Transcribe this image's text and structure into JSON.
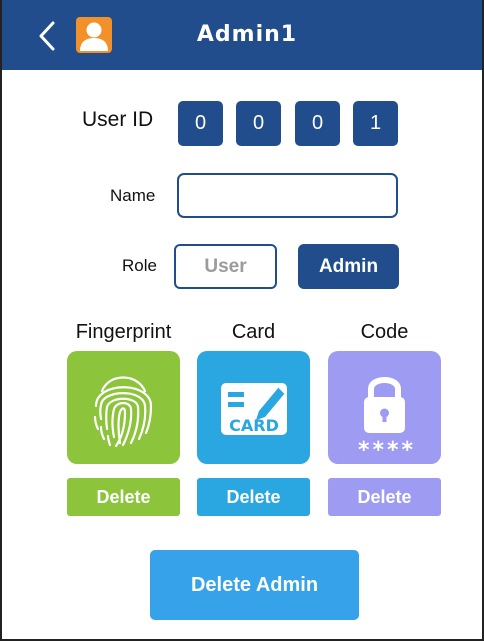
{
  "header": {
    "title": "Admin1",
    "back_icon": "chevron-left-icon",
    "avatar_icon": "user-avatar-icon"
  },
  "user_id": {
    "label": "User ID",
    "digits": [
      "0",
      "0",
      "0",
      "1"
    ]
  },
  "name": {
    "label": "Name",
    "value": "",
    "placeholder": ""
  },
  "role": {
    "label": "Role",
    "options": [
      "User",
      "Admin"
    ],
    "selected": "Admin"
  },
  "credentials": [
    {
      "title": "Fingerprint",
      "icon": "fingerprint-icon",
      "delete_label": "Delete",
      "color": "#8cc43c"
    },
    {
      "title": "Card",
      "icon": "card-icon",
      "card_text": "CARD",
      "delete_label": "Delete",
      "color": "#2aa6e0"
    },
    {
      "title": "Code",
      "icon": "lock-icon",
      "code_text": "****",
      "delete_label": "Delete",
      "color": "#9d9bf2"
    }
  ],
  "delete_admin_label": "Delete Admin",
  "colors": {
    "header": "#214d8c",
    "primary": "#214d8c",
    "accent_avatar": "#f2902a",
    "delete_admin": "#36a2ea"
  }
}
